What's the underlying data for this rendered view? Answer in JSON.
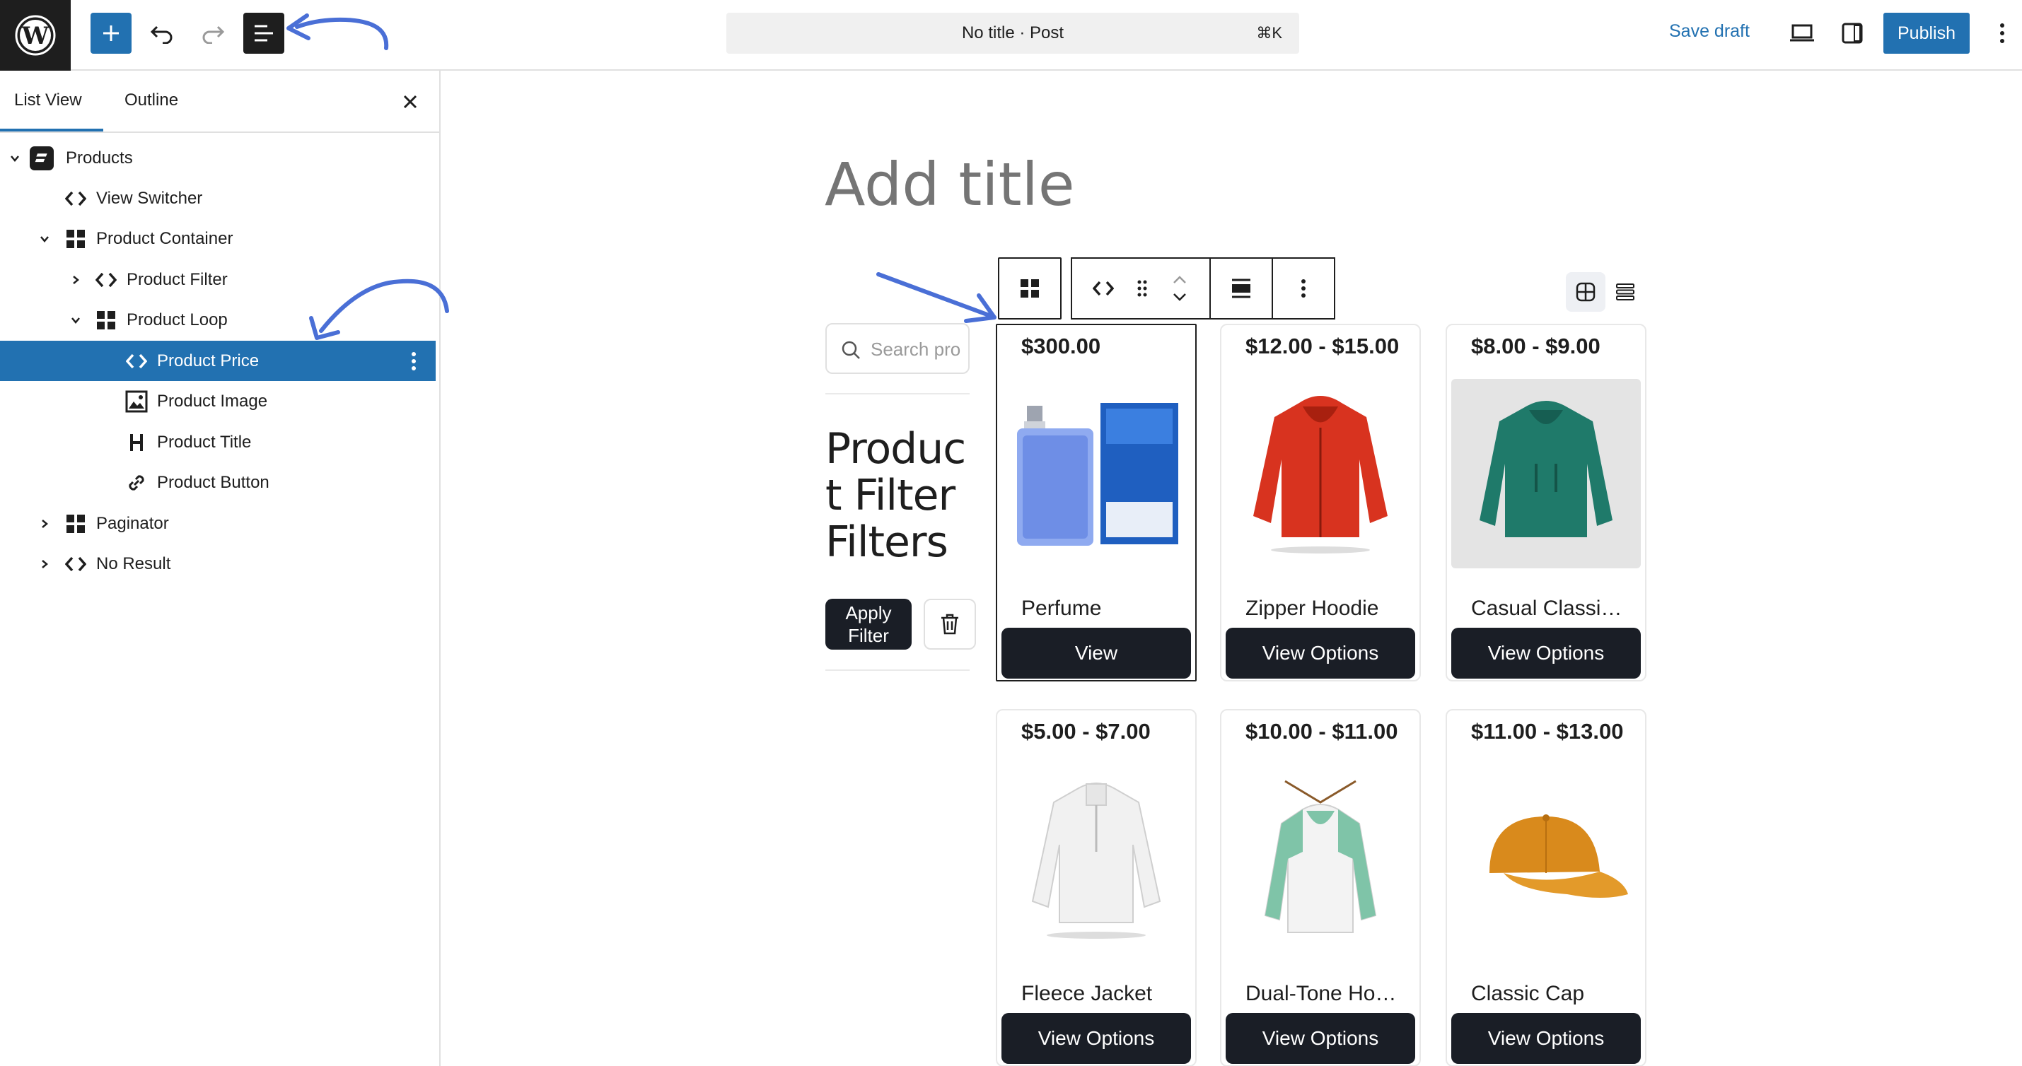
{
  "topbar": {
    "doc_title": "No title · Post",
    "shortcut": "⌘K",
    "save_draft": "Save draft",
    "publish": "Publish"
  },
  "sidebar": {
    "tabs": {
      "list_view": "List View",
      "outline": "Outline"
    },
    "tree": [
      {
        "label": "Products",
        "icon": "product-block-icon"
      },
      {
        "label": "View Switcher",
        "icon": "code-brackets-icon"
      },
      {
        "label": "Product Container",
        "icon": "grid-icon"
      },
      {
        "label": "Product Filter",
        "icon": "code-brackets-icon"
      },
      {
        "label": "Product Loop",
        "icon": "grid-icon"
      },
      {
        "label": "Product Price",
        "icon": "code-brackets-icon",
        "selected": true
      },
      {
        "label": "Product Image",
        "icon": "image-icon"
      },
      {
        "label": "Product Title",
        "icon": "heading-icon"
      },
      {
        "label": "Product Button",
        "icon": "link-icon"
      },
      {
        "label": "Paginator",
        "icon": "grid-icon"
      },
      {
        "label": "No Result",
        "icon": "code-brackets-icon"
      }
    ]
  },
  "editor": {
    "title_placeholder": "Add title",
    "search_placeholder": "Search pro",
    "filter_heading": "Product Filter Filters",
    "apply_filter": "Apply Filter"
  },
  "products": [
    {
      "price": "$300.00",
      "title": "Perfume",
      "button": "View",
      "image": "perfume-image"
    },
    {
      "price": "$12.00 - $15.00",
      "title": "Zipper Hoodie",
      "button": "View Options",
      "image": "red-hoodie-image"
    },
    {
      "price": "$8.00 - $9.00",
      "title": "Casual Classi…",
      "button": "View Options",
      "image": "green-hoodie-image"
    },
    {
      "price": "$5.00 - $7.00",
      "title": "Fleece Jacket",
      "button": "View Options",
      "image": "white-jacket-image"
    },
    {
      "price": "$10.00 - $11.00",
      "title": "Dual-Tone Ho…",
      "button": "View Options",
      "image": "dual-tone-hoodie-image"
    },
    {
      "price": "$11.00 - $13.00",
      "title": "Classic Cap",
      "button": "View Options",
      "image": "orange-cap-image"
    }
  ],
  "colors": {
    "accent": "#2271b1",
    "dark": "#1e1e1e",
    "button_dark": "#1a1e26",
    "annotation_arrow": "#4a6fd6"
  }
}
